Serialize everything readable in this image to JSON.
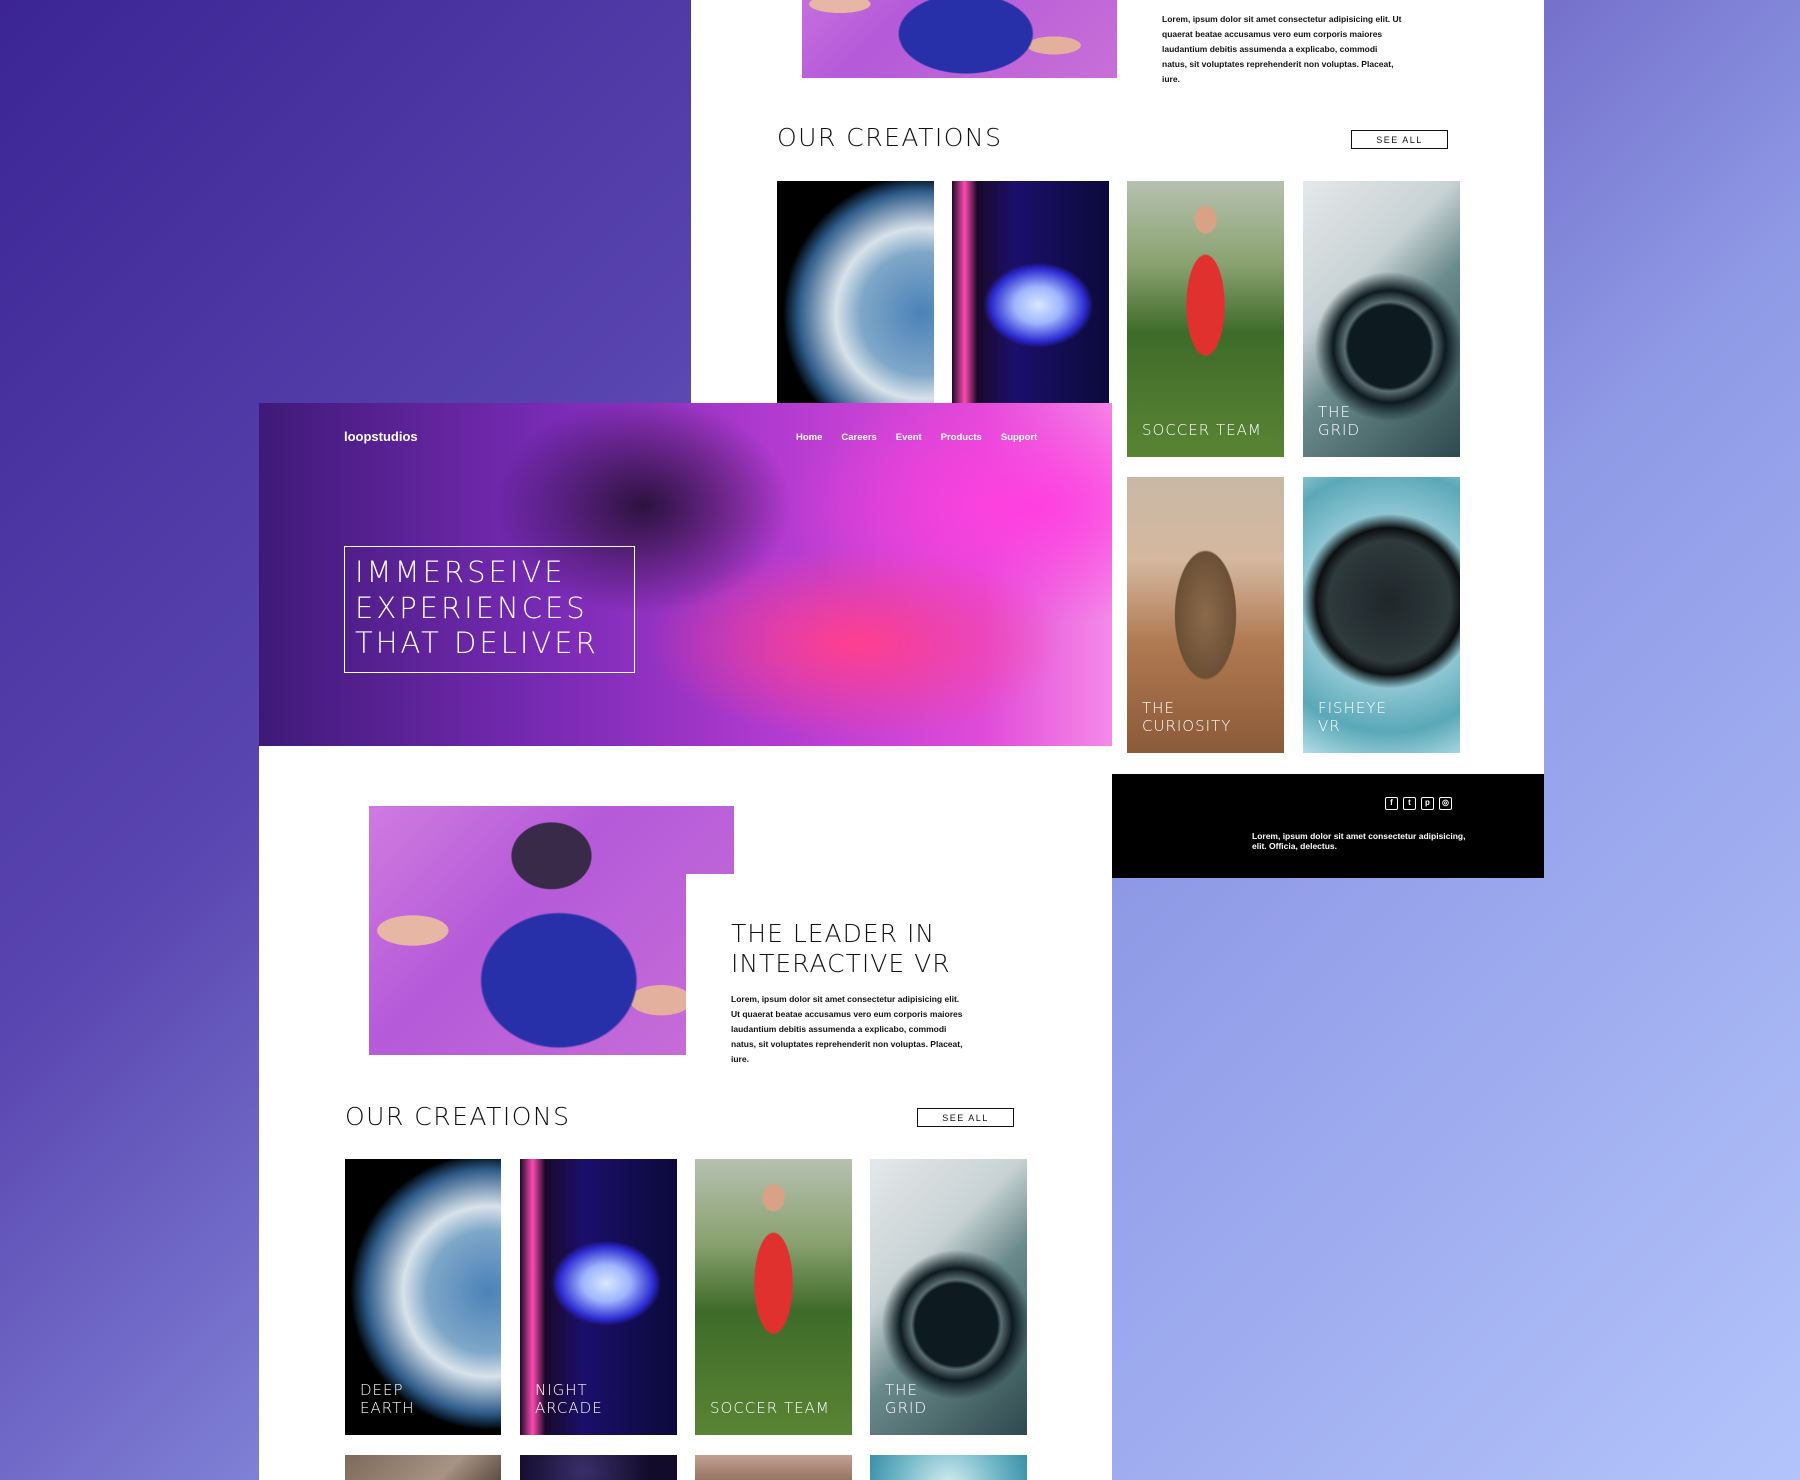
{
  "back_page": {
    "leader_text": "Lorem, ipsum dolor sit amet consectetur adipisicing elit. Ut quaerat beatae accusamus vero eum corporis maiores laudantium debitis assumenda a explicabo, commodi natus, sit voluptates reprehenderit non voluptas. Placeat, iure.",
    "creations_title": "OUR CREATIONS",
    "see_all": "SEE ALL",
    "cards": [
      {
        "line1": "",
        "line2": ""
      },
      {
        "line1": "",
        "line2": ""
      },
      {
        "line1": "SOCCER TEAM",
        "line2": ""
      },
      {
        "line1": "THE",
        "line2": "GRID"
      },
      {
        "line1": "THE",
        "line2": "CURIOSITY"
      },
      {
        "line1": "FISHEYE",
        "line2": "VR"
      }
    ]
  },
  "footer": {
    "social_icons": [
      "facebook-icon",
      "twitter-icon",
      "pinterest-icon",
      "instagram-icon"
    ],
    "social_glyphs": [
      "f",
      "t",
      "p",
      "◎"
    ],
    "text": "Lorem, ipsum dolor sit amet consectetur adipisicing, elit. Officia, delectus."
  },
  "front_page": {
    "logo": "loopstudios",
    "nav": [
      "Home",
      "Careers",
      "Event",
      "Products",
      "Support"
    ],
    "hero": [
      "IMMERSEIVE",
      "EXPERIENCES",
      "THAT DELIVER"
    ],
    "leader_title": [
      "THE LEADER IN",
      "INTERACTIVE VR"
    ],
    "leader_text": "Lorem, ipsum dolor sit amet consectetur adipisicing elit. Ut quaerat beatae accusamus vero eum corporis maiores laudantium debitis assumenda a explicabo, commodi natus, sit voluptates reprehenderit non voluptas. Placeat, iure.",
    "creations_title": "OUR CREATIONS",
    "see_all": "SEE ALL",
    "cards": [
      {
        "line1": "DEEP",
        "line2": "EARTH"
      },
      {
        "line1": "NIGHT",
        "line2": "ARCADE"
      },
      {
        "line1": "SOCCER TEAM",
        "line2": ""
      },
      {
        "line1": "THE",
        "line2": "GRID"
      }
    ]
  }
}
